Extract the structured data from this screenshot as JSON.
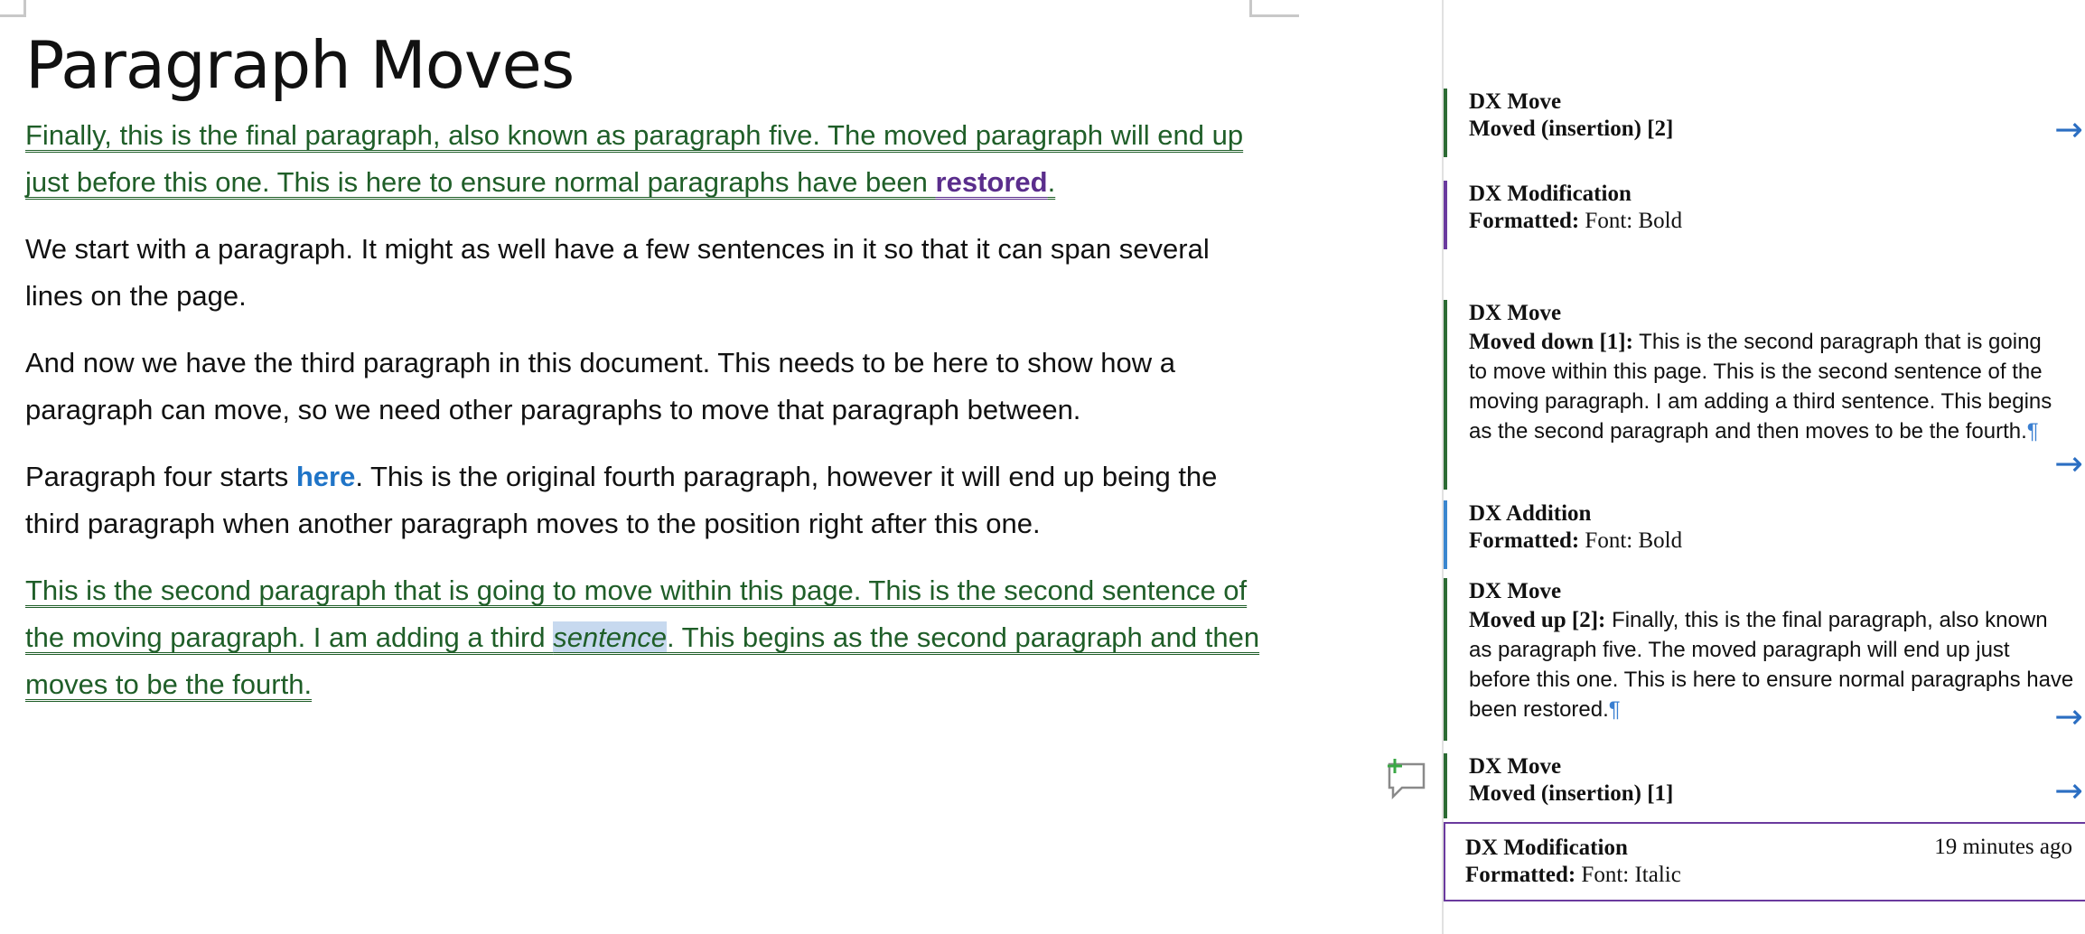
{
  "document": {
    "title": "Paragraph Moves",
    "p1_moved": "Finally, this is the final paragraph, also known as paragraph five. The moved paragraph will end up just before this one. This is here to ensure normal paragraphs have been ",
    "p1_bold": "restored",
    "p1_end": ".",
    "p2": "We start with a paragraph. It might as well have a few sentences in it so that it can span several lines on the page.",
    "p3": "And now we have the third paragraph in this document. This needs to be here to show how a paragraph can move, so we need other paragraphs to move that paragraph between.",
    "p4_start": "Paragraph four starts ",
    "p4_bold": "here",
    "p4_end": ". This is the original fourth paragraph, however it will end up being the third paragraph when another paragraph moves to the position right after this one.",
    "p5_start": "This is the second paragraph that is going to move within this page. This is the second sentence of the moving paragraph. I am adding a third ",
    "p5_italic": "sentence",
    "p5_end": ". This begins as the second paragraph and then moves to be the fourth."
  },
  "markup_pane": {
    "cards": [
      {
        "author": "DX Move",
        "label": "Moved (insertion) [2]"
      },
      {
        "author": "DX Modification",
        "label": "Formatted:",
        "detail": "Font: Bold"
      },
      {
        "author": "DX Move",
        "label": "Moved down [1]:",
        "detail": "This is the second paragraph that is going to move within this page. This is the second sentence of the moving paragraph. I am adding a third sentence. This begins as the second paragraph and then moves to be the fourth.",
        "mark": "¶"
      },
      {
        "author": "DX Addition",
        "label": "Formatted:",
        "detail": "Font: Bold"
      },
      {
        "author": "DX Move",
        "label": "Moved up [2]:",
        "detail": "Finally, this is the final paragraph, also known as paragraph five. The moved paragraph will end up just before this one. This is here to ensure normal paragraphs have been restored.",
        "mark": "¶"
      },
      {
        "author": "DX Move",
        "label": "Moved (insertion) [1]"
      },
      {
        "author": "DX Modification",
        "label": "Formatted:",
        "detail": "Font: Italic",
        "time": "19 minutes ago"
      }
    ],
    "arrow_icon": "→"
  },
  "colors": {
    "moved_text": "#1f5e28",
    "move_bar": "#2c6b34",
    "modification_bar": "#6a3a9e",
    "addition_bar": "#3a86cf",
    "link_bold": "#1f74c7"
  }
}
